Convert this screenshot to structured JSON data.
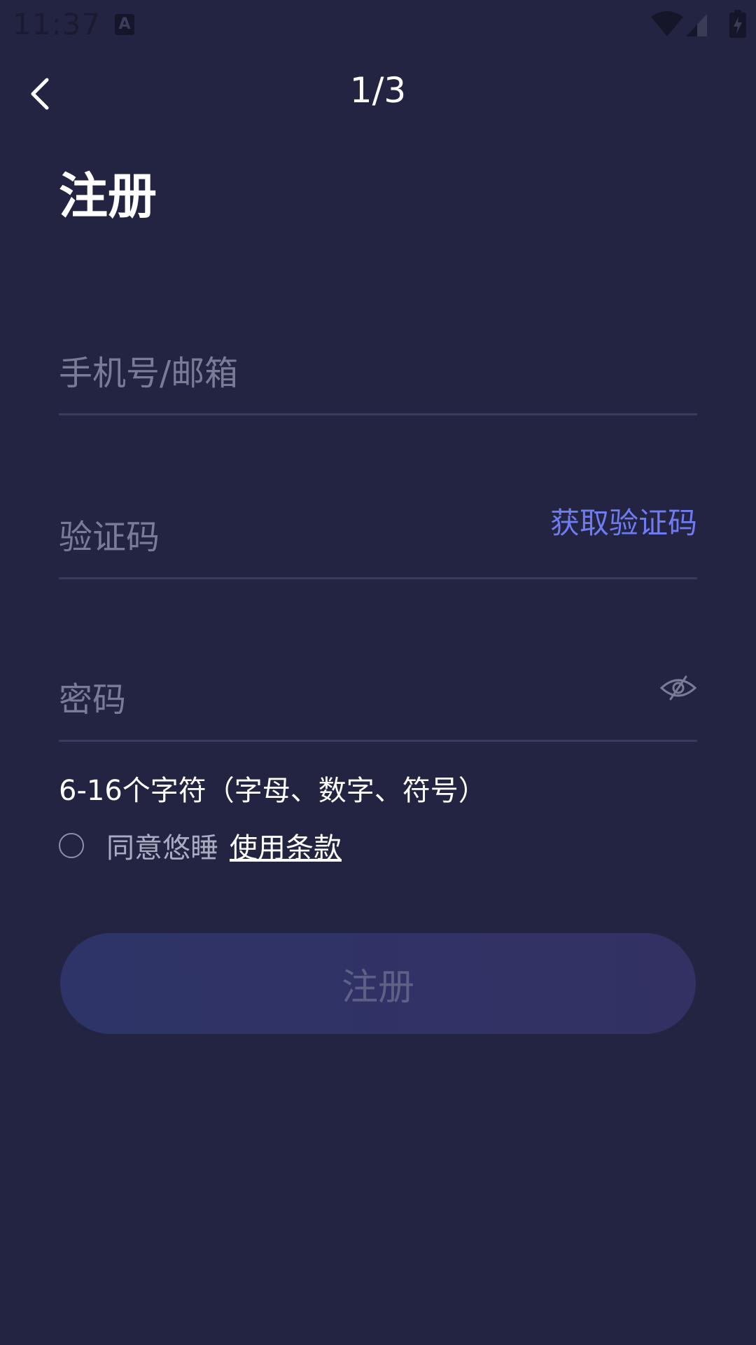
{
  "status_bar": {
    "time": "11:37",
    "app_icon_glyph": "A",
    "icons": [
      "app-notification-icon",
      "wifi-icon",
      "signal-icon",
      "battery-icon"
    ]
  },
  "header": {
    "back_icon": "chevron-left-icon",
    "step": "1/3"
  },
  "title": "注册",
  "fields": {
    "phone_placeholder": "手机号/邮箱",
    "phone_value": "",
    "code_placeholder": "验证码",
    "code_value": "",
    "get_code_label": "获取验证码",
    "password_placeholder": "密码",
    "password_value": "",
    "visibility_icon": "eye-off-icon"
  },
  "password_hint": "6-16个字符（字母、数字、符号）",
  "agreement": {
    "checked": false,
    "text": "同意悠睡",
    "link": "使用条款"
  },
  "submit_label": "注册",
  "colors": {
    "background": "#222442",
    "accent": "#6f7bf0",
    "placeholder": "#7a7c96",
    "divider": "#3a3c5e",
    "button_bg": "#2e3467",
    "button_text_disabled": "#5e6085"
  }
}
